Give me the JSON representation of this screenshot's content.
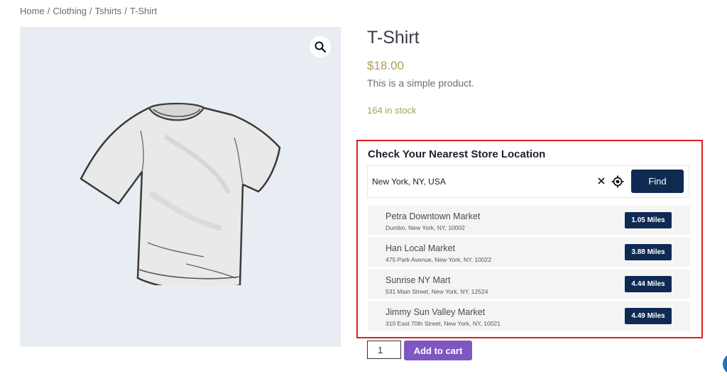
{
  "breadcrumb": {
    "items": [
      "Home",
      "Clothing",
      "Tshirts",
      "T-Shirt"
    ],
    "separator": "/"
  },
  "product": {
    "title": "T-Shirt",
    "price": "$18.00",
    "description": "This is a simple product.",
    "stock": "164 in stock"
  },
  "store_locator": {
    "heading": "Check Your Nearest Store Location",
    "search_value": "New York, NY, USA",
    "find_label": "Find",
    "stores": [
      {
        "name": "Petra Downtown Market",
        "address": "Dumbo, New York, NY, 10002",
        "distance": "1.05 Miles"
      },
      {
        "name": "Han Local Market",
        "address": "475 Park Avenue, New York, NY, 10022",
        "distance": "3.88 Miles"
      },
      {
        "name": "Sunrise NY Mart",
        "address": "531 Main Street, New York, NY, 12524",
        "distance": "4.44 Miles"
      },
      {
        "name": "Jimmy Sun Valley Market",
        "address": "310 East 70th Street, New York, NY, 10021",
        "distance": "4.49 Miles"
      }
    ]
  },
  "cart": {
    "quantity": "1",
    "add_label": "Add to cart"
  },
  "colors": {
    "accent": "#7e57c2",
    "navy": "#0f2a52",
    "price": "#a7a157",
    "highlight_border": "#e02020"
  },
  "icons": [
    "search-icon",
    "close-icon",
    "locate-icon"
  ]
}
